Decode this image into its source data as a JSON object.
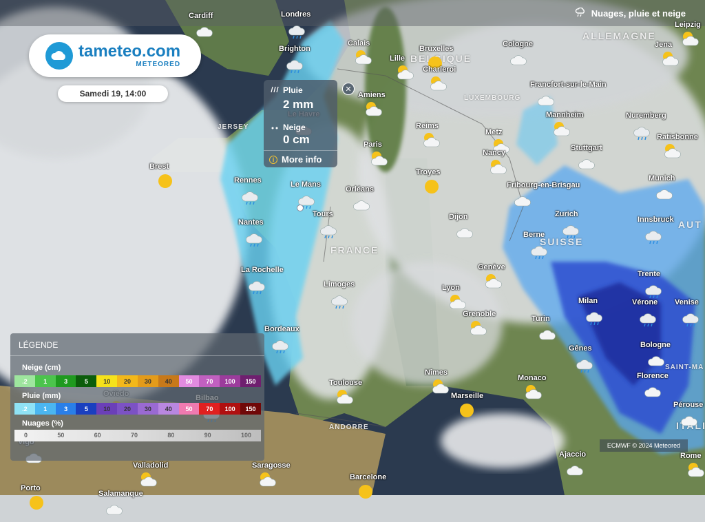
{
  "app": {
    "logo_main": "tameteo.com",
    "logo_sub": "METEORED",
    "date": "Samedi 19, 14:00"
  },
  "layer": {
    "title": "Nuages, pluie et neige",
    "icon": "cloud-rain-icon"
  },
  "popup": {
    "rain_label": "Pluie",
    "rain_value": "2 mm",
    "snow_label": "Neige",
    "snow_value": "0 cm",
    "more_info": "More info",
    "close_icon": "close-icon"
  },
  "legend": {
    "title": "LÉGENDE",
    "snow_title": "Neige (cm)",
    "snow_ticks": [
      ".2",
      "1",
      "3",
      "5",
      "10",
      "20",
      "30",
      "40",
      "50",
      "70",
      "100",
      "150"
    ],
    "rain_title": "Pluie (mm)",
    "rain_ticks": [
      ".2",
      "1",
      "3",
      "5",
      "10",
      "20",
      "30",
      "40",
      "50",
      "70",
      "100",
      "150"
    ],
    "cloud_title": "Nuages (%)",
    "cloud_ticks": [
      "0",
      "50",
      "60",
      "70",
      "80",
      "90",
      "100"
    ],
    "colors": {
      "snow": [
        "#9ee59e",
        "#4cc44c",
        "#1f9a1f",
        "#0b5d0b",
        "#f5e21b",
        "#f3b81a",
        "#e39b1a",
        "#c7791a",
        "#e28be0",
        "#c160c0",
        "#9c3c9c",
        "#6f1f6f"
      ],
      "rain": [
        "#8fe2f5",
        "#4bb6f0",
        "#2a7fe8",
        "#1a3fbf",
        "#6b3fb8",
        "#7c52c4",
        "#9a6ad2",
        "#b987e0",
        "#f07ab0",
        "#e02020",
        "#b01010",
        "#700808"
      ]
    }
  },
  "credit": "ECMWF © 2024 Meteored",
  "countries": {
    "allemagne": "ALLEMAGNE",
    "belgique": "BELGIQUE",
    "luxembourg": "LUXEMBOURG",
    "france": "FRANCE",
    "suisse": "SUISSE",
    "italie": "ITALIE",
    "autriche": "AUT",
    "andorre": "ANDORRE",
    "jersey": "JERSEY",
    "saint_marin": "SAINT-MA"
  },
  "cities": [
    {
      "name": "Cardiff"
    },
    {
      "name": "Londres"
    },
    {
      "name": "Brighton"
    },
    {
      "name": "Calais"
    },
    {
      "name": "Lille"
    },
    {
      "name": "Bruxelles"
    },
    {
      "name": "Charleroi"
    },
    {
      "name": "Cologne"
    },
    {
      "name": "Leipzig"
    },
    {
      "name": "Jena"
    },
    {
      "name": "Amiens"
    },
    {
      "name": "Le Havre"
    },
    {
      "name": "Francfort-sur-le-Main"
    },
    {
      "name": "Reims"
    },
    {
      "name": "Metz"
    },
    {
      "name": "Mannheim"
    },
    {
      "name": "Nuremberg"
    },
    {
      "name": "Ratisbonne"
    },
    {
      "name": "Paris"
    },
    {
      "name": "Nancy"
    },
    {
      "name": "Stuttgart"
    },
    {
      "name": "Brest"
    },
    {
      "name": "Rennes"
    },
    {
      "name": "Le Mans"
    },
    {
      "name": "Orléans"
    },
    {
      "name": "Troyes"
    },
    {
      "name": "Fribourg-en-Brisgau"
    },
    {
      "name": "Munich"
    },
    {
      "name": "Nantes"
    },
    {
      "name": "Tours"
    },
    {
      "name": "Dijon"
    },
    {
      "name": "Zurich"
    },
    {
      "name": "Innsbruck"
    },
    {
      "name": "Berne"
    },
    {
      "name": "La Rochelle"
    },
    {
      "name": "Limoges"
    },
    {
      "name": "Genève"
    },
    {
      "name": "Lyon"
    },
    {
      "name": "Trente"
    },
    {
      "name": "Vérone"
    },
    {
      "name": "Venise"
    },
    {
      "name": "Milan"
    },
    {
      "name": "Grenoble"
    },
    {
      "name": "Turin"
    },
    {
      "name": "Bordeaux"
    },
    {
      "name": "Bologne"
    },
    {
      "name": "Gênes"
    },
    {
      "name": "Nîmes"
    },
    {
      "name": "Florence"
    },
    {
      "name": "Monaco"
    },
    {
      "name": "Toulouse"
    },
    {
      "name": "Marseille"
    },
    {
      "name": "Pérouse"
    },
    {
      "name": "Ovièdo"
    },
    {
      "name": "Bilbao"
    },
    {
      "name": "Vigo"
    },
    {
      "name": "Valladolid"
    },
    {
      "name": "Saragosse"
    },
    {
      "name": "Ajaccio"
    },
    {
      "name": "Rome"
    },
    {
      "name": "Barcelone"
    },
    {
      "name": "Porto"
    },
    {
      "name": "Salamanque"
    }
  ]
}
